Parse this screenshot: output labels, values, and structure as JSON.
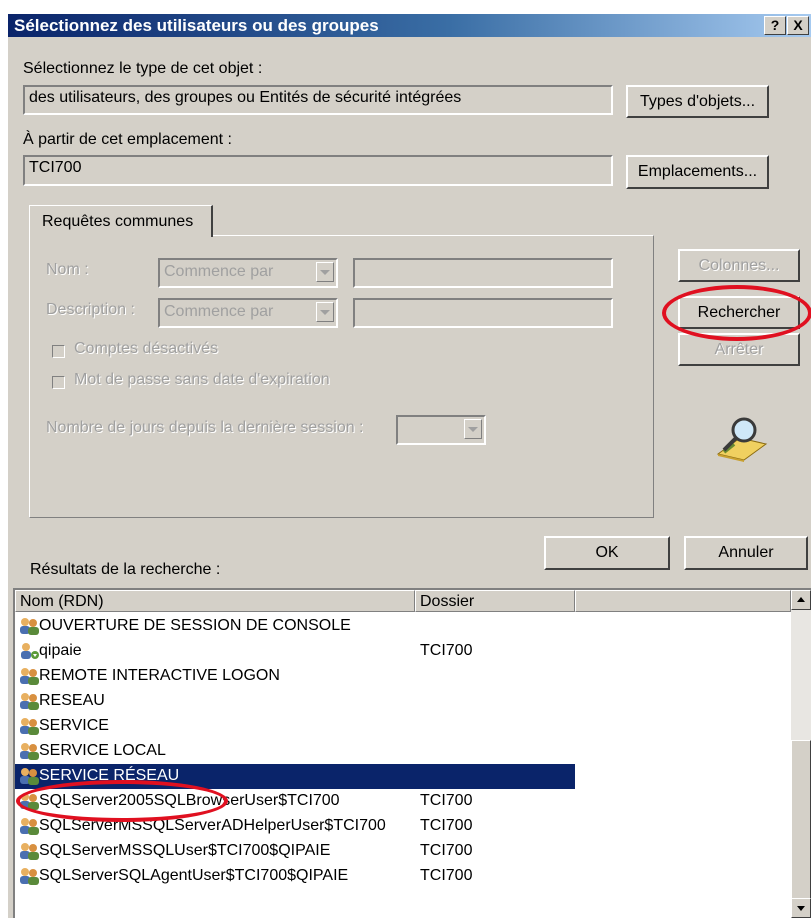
{
  "window": {
    "title": "Sélectionnez des utilisateurs ou des groupes",
    "help_label": "?",
    "close_label": "X"
  },
  "object_type": {
    "label": "Sélectionnez le type de cet objet :",
    "value": "des utilisateurs, des groupes ou Entités de sécurité intégrées",
    "button": "Types d'objets..."
  },
  "location": {
    "label": "À partir de cet emplacement :",
    "value": "TCI700",
    "button": "Emplacements..."
  },
  "query": {
    "tab_label": "Requêtes communes",
    "name_label": "Nom :",
    "name_mode": "Commence par",
    "description_label": "Description :",
    "description_mode": "Commence par",
    "disabled_accounts_label": "Comptes désactivés",
    "non_expiring_password_label": "Mot de passe sans date d'expiration",
    "days_since_logon_label": "Nombre de jours depuis la dernière session :"
  },
  "side_buttons": {
    "columns": "Colonnes...",
    "search": "Rechercher",
    "stop": "Arrêter"
  },
  "footer": {
    "ok": "OK",
    "cancel": "Annuler"
  },
  "results": {
    "label": "Résultats de la recherche :",
    "columns": [
      "Nom (RDN)",
      "Dossier"
    ],
    "rows": [
      {
        "name": "OUVERTURE DE SESSION DE CONSOLE",
        "folder": "",
        "icon": "group-icon"
      },
      {
        "name": "qipaie",
        "folder": "TCI700",
        "icon": "user-icon"
      },
      {
        "name": "REMOTE INTERACTIVE LOGON",
        "folder": "",
        "icon": "group-icon"
      },
      {
        "name": "RESEAU",
        "folder": "",
        "icon": "group-icon"
      },
      {
        "name": "SERVICE",
        "folder": "",
        "icon": "group-icon"
      },
      {
        "name": "SERVICE LOCAL",
        "folder": "",
        "icon": "group-icon"
      },
      {
        "name": "SERVICE RÉSEAU",
        "folder": "",
        "icon": "group-icon",
        "selected": true
      },
      {
        "name": "SQLServer2005SQLBrowserUser$TCI700",
        "folder": "TCI700",
        "icon": "group-icon"
      },
      {
        "name": "SQLServerMSSQLServerADHelperUser$TCI700",
        "folder": "TCI700",
        "icon": "group-icon"
      },
      {
        "name": "SQLServerMSSQLUser$TCI700$QIPAIE",
        "folder": "TCI700",
        "icon": "group-icon"
      },
      {
        "name": "SQLServerSQLAgentUser$TCI700$QIPAIE",
        "folder": "TCI700",
        "icon": "group-icon"
      }
    ]
  },
  "colors": {
    "titlebar": "#0a246a",
    "selection": "#0a246a",
    "annotation": "#e01020"
  }
}
